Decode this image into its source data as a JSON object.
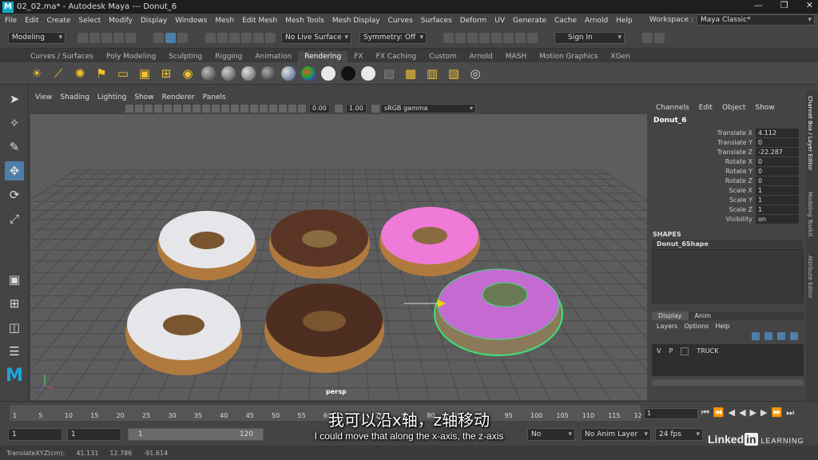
{
  "title_bar": {
    "text": "02_02.ma* - Autodesk Maya   ---   Donut_6",
    "controls": [
      "—",
      "❐",
      "✕"
    ]
  },
  "menu": [
    "File",
    "Edit",
    "Create",
    "Select",
    "Modify",
    "Display",
    "Windows",
    "Mesh",
    "Edit Mesh",
    "Mesh Tools",
    "Mesh Display",
    "Curves",
    "Surfaces",
    "Deform",
    "UV",
    "Generate",
    "Cache",
    "Arnold",
    "Help"
  ],
  "workspace": {
    "label": "Workspace :",
    "value": "Maya Classic*"
  },
  "status_line": {
    "mode": "Modeling",
    "live_surface": "No Live Surface",
    "symmetry": "Symmetry: Off",
    "sign_in": "Sign In"
  },
  "shelf_tabs": [
    "Curves / Surfaces",
    "Poly Modeling",
    "Sculpting",
    "Rigging",
    "Animation",
    "Rendering",
    "FX",
    "FX Caching",
    "Custom",
    "Arnold",
    "MASH",
    "Motion Graphics",
    "XGen"
  ],
  "shelf_active": "Rendering",
  "viewport": {
    "menu": [
      "View",
      "Shading",
      "Lighting",
      "Show",
      "Renderer",
      "Panels"
    ],
    "value1": "0.00",
    "value2": "1.00",
    "color_space": "sRGB gamma",
    "camera": "persp"
  },
  "channel_box": {
    "header": [
      "Channels",
      "Edit",
      "Object",
      "Show"
    ],
    "object": "Donut_6",
    "attributes": [
      {
        "name": "Translate X",
        "value": "4.112"
      },
      {
        "name": "Translate Y",
        "value": "0"
      },
      {
        "name": "Translate Z",
        "value": "-22.287"
      },
      {
        "name": "Rotate X",
        "value": "0"
      },
      {
        "name": "Rotate Y",
        "value": "0"
      },
      {
        "name": "Rotate Z",
        "value": "0"
      },
      {
        "name": "Scale X",
        "value": "1"
      },
      {
        "name": "Scale Y",
        "value": "1"
      },
      {
        "name": "Scale Z",
        "value": "1"
      },
      {
        "name": "Visibility",
        "value": "on"
      }
    ],
    "shapes_header": "SHAPES",
    "shape": "Donut_6Shape"
  },
  "layers": {
    "tabs": [
      "Display",
      "Anim"
    ],
    "menu": [
      "Layers",
      "Options",
      "Help"
    ],
    "row": {
      "v": "V",
      "p": "P",
      "name": "TRUCK"
    }
  },
  "side_tabs": [
    "Channel Box / Layer Editor",
    "Modeling Toolkit",
    "Attribute Editor"
  ],
  "timeline": {
    "ticks": [
      "1",
      "5",
      "10",
      "15",
      "20",
      "25",
      "30",
      "35",
      "40",
      "45",
      "50",
      "55",
      "60",
      "65",
      "70",
      "75",
      "80",
      "85",
      "90",
      "95",
      "100",
      "105",
      "110",
      "115",
      "12"
    ],
    "current_frame": "1"
  },
  "range": {
    "start": "1",
    "playback_start": "1",
    "slider_start": "1",
    "slider_end": "120",
    "character_set": "No Character Set",
    "anim_layer": "No Anim Layer",
    "fps": "24 fps"
  },
  "command_line": {
    "label": "TranslateXYZ(cm):",
    "x": "41.131",
    "y": "12.786",
    "z": "-91.614"
  },
  "subtitles": {
    "zh": "我可以沿x轴，z轴移动",
    "en": "I could move that along the x-axis, the z-axis"
  },
  "watermark": {
    "brand": "Linked",
    "in": "in",
    "suffix": "LEARNING"
  }
}
